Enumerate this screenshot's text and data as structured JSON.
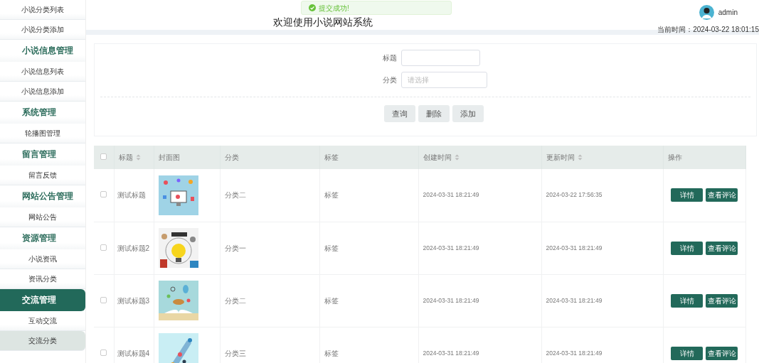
{
  "sidebar": {
    "items": [
      {
        "kind": "item",
        "label": "小说分类列表",
        "selected": false,
        "hovered": false
      },
      {
        "kind": "item",
        "label": "小说分类添加",
        "selected": false,
        "hovered": false
      },
      {
        "kind": "group",
        "label": "小说信息管理",
        "selected": false,
        "hovered": false
      },
      {
        "kind": "item",
        "label": "小说信息列表",
        "selected": false,
        "hovered": false
      },
      {
        "kind": "item",
        "label": "小说信息添加",
        "selected": false,
        "hovered": false
      },
      {
        "kind": "group",
        "label": "系统管理",
        "selected": false,
        "hovered": false
      },
      {
        "kind": "item",
        "label": "轮播图管理",
        "selected": false,
        "hovered": false
      },
      {
        "kind": "group",
        "label": "留言管理",
        "selected": false,
        "hovered": false
      },
      {
        "kind": "item",
        "label": "留言反馈",
        "selected": false,
        "hovered": false
      },
      {
        "kind": "group",
        "label": "网站公告管理",
        "selected": false,
        "hovered": false
      },
      {
        "kind": "item",
        "label": "网站公告",
        "selected": false,
        "hovered": false
      },
      {
        "kind": "group",
        "label": "资源管理",
        "selected": false,
        "hovered": false
      },
      {
        "kind": "item",
        "label": "小说资讯",
        "selected": false,
        "hovered": false
      },
      {
        "kind": "item",
        "label": "资讯分类",
        "selected": false,
        "hovered": false
      },
      {
        "kind": "group",
        "label": "交流管理",
        "selected": true,
        "hovered": false
      },
      {
        "kind": "item",
        "label": "互动交流",
        "selected": false,
        "hovered": false
      },
      {
        "kind": "item",
        "label": "交流分类",
        "selected": false,
        "hovered": true
      }
    ]
  },
  "header": {
    "title": "欢迎使用小说网站系统",
    "toast": "提交成功!",
    "user": "admin",
    "time_label": "当前时间：",
    "time": "2024-03-22 18:01:15"
  },
  "search": {
    "fields": [
      {
        "label": "标题",
        "kind": "input"
      },
      {
        "label": "分类",
        "kind": "select",
        "placeholder": "请选择"
      }
    ],
    "buttons": [
      "查询",
      "删除",
      "添加"
    ]
  },
  "table": {
    "select_all_checked": false,
    "columns": [
      {
        "label": "标题",
        "sortable": true
      },
      {
        "label": "封面图",
        "sortable": false
      },
      {
        "label": "分类",
        "sortable": false
      },
      {
        "label": "标签",
        "sortable": false
      },
      {
        "label": "创建时间",
        "sortable": true
      },
      {
        "label": "更新时间",
        "sortable": true
      },
      {
        "label": "操作",
        "sortable": false
      }
    ],
    "rows": [
      {
        "checked": false,
        "title": "测试标题",
        "category": "分类二",
        "tag": "标签",
        "created": "2024-03-31 18:21:49",
        "updated": "2024-03-22 17:56:35",
        "actions": [
          "详情",
          "查看评论"
        ]
      },
      {
        "checked": false,
        "title": "测试标题2",
        "category": "分类一",
        "tag": "标签",
        "created": "2024-03-31 18:21:49",
        "updated": "2024-03-31 18:21:49",
        "actions": [
          "详情",
          "查看评论"
        ]
      },
      {
        "checked": false,
        "title": "测试标题3",
        "category": "分类二",
        "tag": "标签",
        "created": "2024-03-31 18:21:49",
        "updated": "2024-03-31 18:21:49",
        "actions": [
          "详情",
          "查看评论"
        ]
      },
      {
        "checked": false,
        "title": "测试标题4",
        "category": "分类三",
        "tag": "标签",
        "created": "2024-03-31 18:21:49",
        "updated": "2024-03-31 18:21:49",
        "actions": [
          "详情",
          "查看评论"
        ]
      }
    ]
  }
}
